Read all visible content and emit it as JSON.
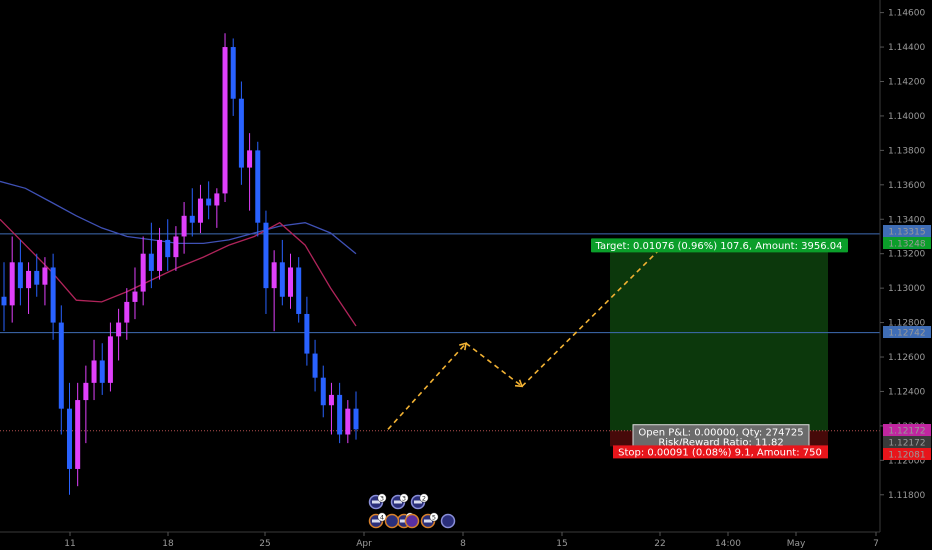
{
  "colors": {
    "background": "#000000",
    "grid_line": "#2a2e39",
    "axis_text": "#9a9a9a",
    "candle_up": "#e040fb",
    "candle_down": "#2962ff",
    "ma_slow": "#3f51b5",
    "ma_fast": "#b0245a",
    "hline": "#3f6db5",
    "current_price_line": "#b44f4f",
    "target_zone": "#0d3b0d",
    "stop_zone": "#4a0a0a",
    "target_label_bg": "#0b9e2a",
    "stop_label_bg": "#e8151b",
    "pnl_label_bg": "#6b6b6b",
    "projection_arrow": "#f2b233"
  },
  "chart_data": {
    "type": "candlestick",
    "y_axis": {
      "range": [
        1.117,
        1.1465
      ],
      "ticks": [
        "1.11800",
        "1.12000",
        "1.12200",
        "1.12400",
        "1.12600",
        "1.12800",
        "1.13000",
        "1.13200",
        "1.13400",
        "1.13600",
        "1.13800",
        "1.14000",
        "1.14200",
        "1.14400",
        "1.14600"
      ]
    },
    "x_axis": {
      "ticks": [
        "11",
        "18",
        "25",
        "Apr",
        "8",
        "15",
        "22",
        "14:00",
        "May",
        "7"
      ]
    },
    "candles": [
      [
        1.1295,
        1.1315,
        1.1275,
        1.129
      ],
      [
        1.129,
        1.133,
        1.128,
        1.1315
      ],
      [
        1.1315,
        1.1328,
        1.129,
        1.13
      ],
      [
        1.13,
        1.1315,
        1.1285,
        1.131
      ],
      [
        1.131,
        1.132,
        1.1295,
        1.1302
      ],
      [
        1.1302,
        1.1318,
        1.129,
        1.1312
      ],
      [
        1.1312,
        1.132,
        1.127,
        1.128
      ],
      [
        1.128,
        1.129,
        1.1215,
        1.123
      ],
      [
        1.123,
        1.1245,
        1.118,
        1.1195
      ],
      [
        1.1195,
        1.1245,
        1.1185,
        1.1235
      ],
      [
        1.1235,
        1.1255,
        1.121,
        1.1245
      ],
      [
        1.1245,
        1.127,
        1.1235,
        1.1258
      ],
      [
        1.1258,
        1.1268,
        1.1238,
        1.1245
      ],
      [
        1.1245,
        1.128,
        1.124,
        1.1272
      ],
      [
        1.1272,
        1.1288,
        1.1258,
        1.128
      ],
      [
        1.128,
        1.13,
        1.127,
        1.1292
      ],
      [
        1.1292,
        1.1312,
        1.1282,
        1.1298
      ],
      [
        1.1298,
        1.133,
        1.129,
        1.132
      ],
      [
        1.132,
        1.1338,
        1.13,
        1.131
      ],
      [
        1.131,
        1.1335,
        1.1305,
        1.1328
      ],
      [
        1.1328,
        1.134,
        1.131,
        1.1318
      ],
      [
        1.1318,
        1.1336,
        1.131,
        1.133
      ],
      [
        1.133,
        1.135,
        1.132,
        1.1342
      ],
      [
        1.1342,
        1.1358,
        1.133,
        1.1338
      ],
      [
        1.1338,
        1.136,
        1.1332,
        1.1352
      ],
      [
        1.1352,
        1.1362,
        1.134,
        1.1348
      ],
      [
        1.1348,
        1.1358,
        1.1335,
        1.1355
      ],
      [
        1.1355,
        1.1448,
        1.135,
        1.144
      ],
      [
        1.144,
        1.1445,
        1.14,
        1.141
      ],
      [
        1.141,
        1.142,
        1.136,
        1.137
      ],
      [
        1.137,
        1.139,
        1.1345,
        1.138
      ],
      [
        1.138,
        1.1385,
        1.133,
        1.1338
      ],
      [
        1.1338,
        1.1345,
        1.1285,
        1.13
      ],
      [
        1.13,
        1.1322,
        1.1275,
        1.1315
      ],
      [
        1.1315,
        1.1328,
        1.129,
        1.1295
      ],
      [
        1.1295,
        1.132,
        1.1288,
        1.1312
      ],
      [
        1.1312,
        1.1318,
        1.128,
        1.1285
      ],
      [
        1.1285,
        1.1295,
        1.1255,
        1.1262
      ],
      [
        1.1262,
        1.127,
        1.124,
        1.1248
      ],
      [
        1.1248,
        1.1255,
        1.1225,
        1.1232
      ],
      [
        1.1232,
        1.1245,
        1.1215,
        1.1238
      ],
      [
        1.1238,
        1.1245,
        1.121,
        1.1215
      ],
      [
        1.1215,
        1.1235,
        1.121,
        1.123
      ],
      [
        1.123,
        1.124,
        1.1212,
        1.1218
      ]
    ],
    "moving_averages": [
      {
        "values": [
          1.1362,
          1.1358,
          1.135,
          1.1342,
          1.1335,
          1.133,
          1.1328,
          1.1326,
          1.1326,
          1.1328,
          1.1332,
          1.1336,
          1.1338,
          1.1332,
          1.132
        ]
      },
      {
        "values": [
          1.134,
          1.1325,
          1.131,
          1.1293,
          1.1292,
          1.1298,
          1.1305,
          1.1312,
          1.1318,
          1.1325,
          1.133,
          1.1338,
          1.1325,
          1.13,
          1.1278
        ]
      }
    ],
    "horizontal_lines": [
      1.13315,
      1.12742
    ],
    "current_price": 1.12172,
    "position": {
      "target_price": 1.13248,
      "entry_price": 1.12172,
      "stop_price": 1.12081,
      "target_label": "Target: 0.01076 (0.96%) 107.6, Amount: 3956.04",
      "pnl_label_line1": "Open P&L: 0.00000, Qty: 274725",
      "pnl_label_line2": "Risk/Reward Ratio: 11.82",
      "stop_label": "Stop: 0.00091 (0.08%) 9.1, Amount: 750"
    },
    "price_tags": [
      {
        "text": "1.13315",
        "price": 1.13315,
        "color": "#3f6db5"
      },
      {
        "text": "1.13248",
        "price": 1.13248,
        "color": "#0b9e2a"
      },
      {
        "text": "1.12742",
        "price": 1.12742,
        "color": "#3f6db5"
      },
      {
        "text": "1.12172",
        "price": 1.12172,
        "color": "#c026a0"
      },
      {
        "text": "1.12172",
        "price": 1.12172,
        "color": "#3a3a3a"
      },
      {
        "text": "1.12081",
        "price": 1.12081,
        "color": "#e8151b"
      }
    ],
    "projection_path": [
      [
        1.1218
      ],
      [
        1.1268
      ],
      [
        1.1243
      ],
      [
        1.1325
      ]
    ],
    "event_markers": {
      "row1": [
        "3",
        "3",
        "2"
      ],
      "row2": [
        "4",
        "3",
        "5"
      ]
    }
  }
}
